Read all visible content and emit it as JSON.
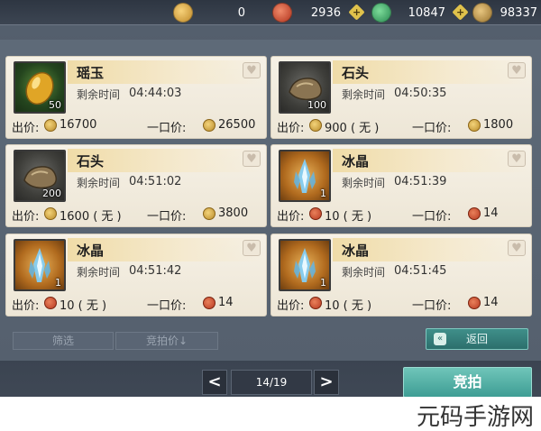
{
  "currencies": [
    {
      "name": "gold-coin-icon",
      "value": "0",
      "color": "#d9a23a"
    },
    {
      "name": "red-gem-icon",
      "value": "2936",
      "color": "#c7442a"
    },
    {
      "name": "jade-icon",
      "value": "10847",
      "color": "#3aa36a"
    },
    {
      "name": "silver-coin-icon",
      "value": "98337",
      "color": "#b8924a"
    }
  ],
  "plus_label": "+",
  "labels": {
    "time_remaining": "剩余时间",
    "price": "出价:",
    "buyout": "一口价:"
  },
  "items": [
    {
      "name": "瑶玉",
      "qty": "50",
      "time": "04:44:03",
      "price": "16700",
      "buyout": "26500",
      "coin": "gold",
      "thumb": "green",
      "art": "jade"
    },
    {
      "name": "石头",
      "qty": "100",
      "time": "04:50:35",
      "price": "900 ( 无 )",
      "buyout": "1800",
      "coin": "gold",
      "thumb": "grey",
      "art": "stone"
    },
    {
      "name": "石头",
      "qty": "200",
      "time": "04:51:02",
      "price": "1600 ( 无 )",
      "buyout": "3800",
      "coin": "gold",
      "thumb": "grey",
      "art": "stone"
    },
    {
      "name": "冰晶",
      "qty": "1",
      "time": "04:51:39",
      "price": "10 ( 无 )",
      "buyout": "14",
      "coin": "red",
      "thumb": "orange",
      "art": "ice"
    },
    {
      "name": "冰晶",
      "qty": "1",
      "time": "04:51:42",
      "price": "10 ( 无 )",
      "buyout": "14",
      "coin": "red",
      "thumb": "orange",
      "art": "ice"
    },
    {
      "name": "冰晶",
      "qty": "1",
      "time": "04:51:45",
      "price": "10 ( 无 )",
      "buyout": "14",
      "coin": "red",
      "thumb": "orange",
      "art": "ice"
    }
  ],
  "controls": {
    "filter": "筛选",
    "bid_sort": "竞拍价↓",
    "back": "返回",
    "page": "14/19",
    "bid": "竞拍",
    "prev": "<",
    "next": ">"
  },
  "watermark": "元码手游网"
}
